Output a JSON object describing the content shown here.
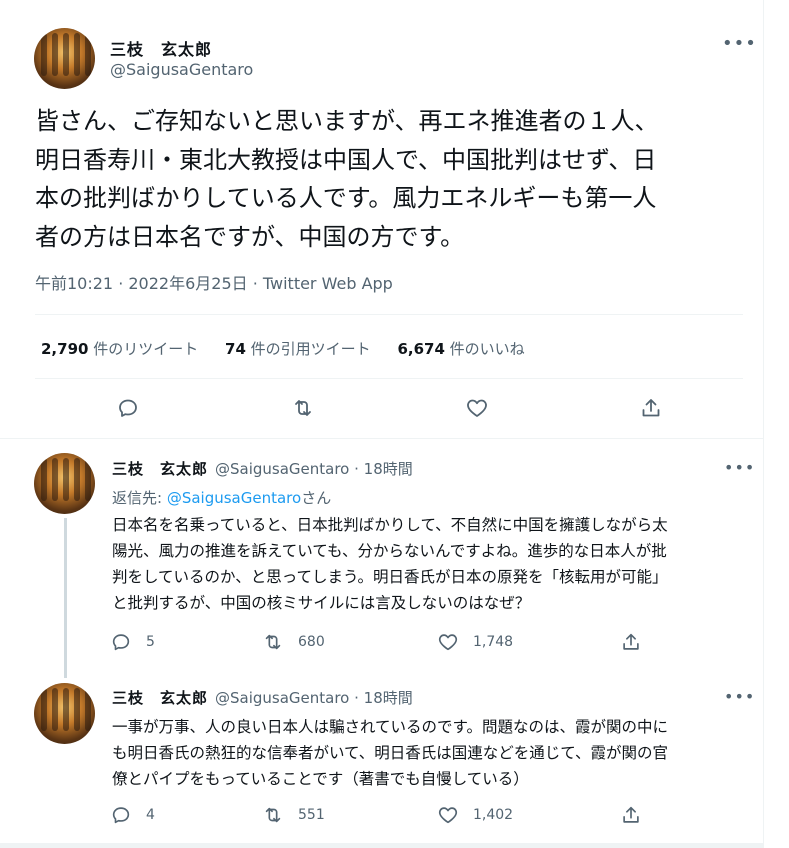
{
  "main_tweet": {
    "author_name": "三枝　玄太郎",
    "author_handle": "@SaigusaGentaro",
    "text": "皆さん、ご存知ないと思いますが、再エネ推進者の１人、\n明日香寿川・東北大教授は中国人で、中国批判はせず、日\n本の批判ばかりしている人です。風力エネルギーも第一人\n者の方は日本名ですが、中国の方です。",
    "timestamp": "午前10:21 · 2022年6月25日 · Twitter Web App",
    "retweets_count": "2,790",
    "retweets_label": " 件のリツイート",
    "quotes_count": "74",
    "quotes_label": " 件の引用ツイート",
    "likes_count": "6,674",
    "likes_label": " 件のいいね",
    "more_icon": "more-horizontal-icon"
  },
  "replies": [
    {
      "author_name": "三枝　玄太郎",
      "author_handle": "@SaigusaGentaro · 18時間",
      "reply_to_prefix": "返信先: ",
      "reply_to_handle": "@SaigusaGentaro",
      "reply_to_suffix": "さん",
      "text": "日本名を名乗っていると、日本批判ばかりして、不自然に中国を擁護しながら太\n陽光、風力の推進を訴えていても、分からないんですよね。進歩的な日本人が批\n判をしているのか、と思ってしまう。明日香氏が日本の原発を「核転用が可能」\nと批判するが、中国の核ミサイルには言及しないのはなぜ？",
      "reply_count": "5",
      "retweet_count": "680",
      "like_count": "1,748"
    },
    {
      "author_name": "三枝　玄太郎",
      "author_handle": "@SaigusaGentaro · 18時間",
      "text": "一事が万事、人の良い日本人は騙されているのです。問題なのは、霞が関の中に\nも明日香氏の熱狂的な信奉者がいて、明日香氏は国連などを通じて、霞が関の官\n僚とパイプをもっていることです（著書でも自慢している）",
      "reply_count": "4",
      "retweet_count": "551",
      "like_count": "1,402"
    }
  ],
  "icons": {
    "reply": "reply-icon",
    "retweet": "retweet-icon",
    "like": "heart-icon",
    "share": "share-icon"
  },
  "colors": {
    "text_primary": "#0f1419",
    "text_secondary": "#536471",
    "link": "#1d9bf0",
    "divider": "#eff3f4"
  }
}
